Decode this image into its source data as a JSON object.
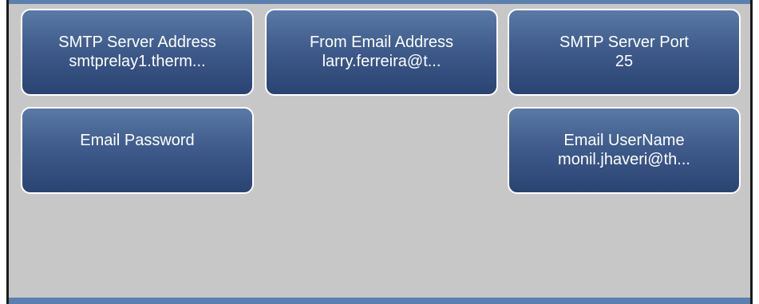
{
  "settings_tiles": [
    {
      "label": "SMTP Server Address",
      "value": "smtprelay1.therm..."
    },
    {
      "label": "From Email Address",
      "value": "larry.ferreira@t..."
    },
    {
      "label": "SMTP Server Port",
      "value": "25"
    },
    {
      "label": "Email Password",
      "value": ""
    },
    {
      "label": "Email UserName",
      "value": "monil.jhaveri@th..."
    }
  ],
  "colors": {
    "tile_top": "#5a79a6",
    "tile_bottom": "#2a4372",
    "tile_border": "#ffffff",
    "background": "#c7c7c7",
    "accent_bar": "#5b7fae"
  }
}
